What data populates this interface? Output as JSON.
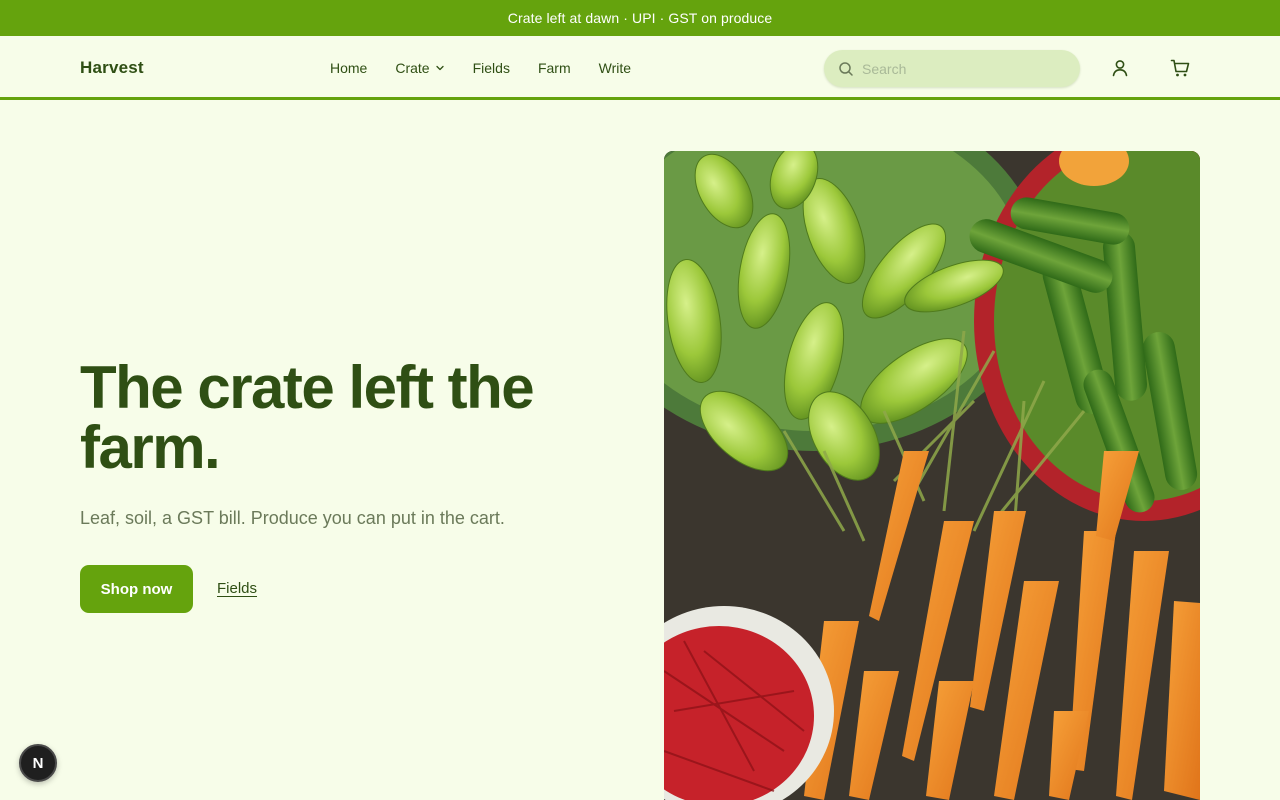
{
  "announcement": "Crate left at dawn · UPI · GST on produce",
  "header": {
    "brand": "Harvest",
    "nav": {
      "home": "Home",
      "crate": "Crate",
      "fields": "Fields",
      "farm": "Farm",
      "write": "Write"
    },
    "search_placeholder": "Search",
    "icons": {
      "search": "search-icon",
      "account": "user-icon",
      "cart": "cart-icon",
      "chevron": "chevron-down-icon"
    }
  },
  "hero": {
    "title": "The crate left the farm.",
    "subtitle": "Leaf, soil, a GST bill. Produce you can put in the cart.",
    "primary_cta": "Shop now",
    "secondary_cta": "Fields",
    "image": "vegetables-photo"
  },
  "fab": {
    "label": "N"
  },
  "colors": {
    "accent": "#65a30d",
    "background": "#f7fde9",
    "heading": "#2f4f14",
    "search_bg": "#dcedc0",
    "muted_text": "#6b7a5a"
  }
}
